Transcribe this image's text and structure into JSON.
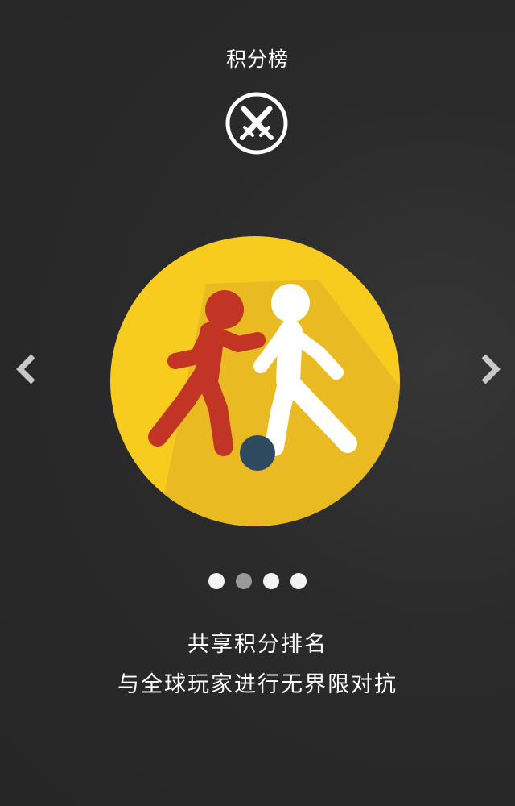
{
  "header": {
    "title": "积分榜",
    "icon": "crossed-swords-icon"
  },
  "carousel": {
    "prev_icon": "chevron-left-icon",
    "next_icon": "chevron-right-icon",
    "illustration": "soccer-players-icon",
    "colors": {
      "circle": "#f7cc1f",
      "player_red": "#c23424",
      "player_white": "#ffffff",
      "ball": "#2e4a5e"
    },
    "page_count": 4,
    "active_page": 2
  },
  "caption": {
    "line1": "共享积分排名",
    "line2": "与全球玩家进行无界限对抗"
  }
}
